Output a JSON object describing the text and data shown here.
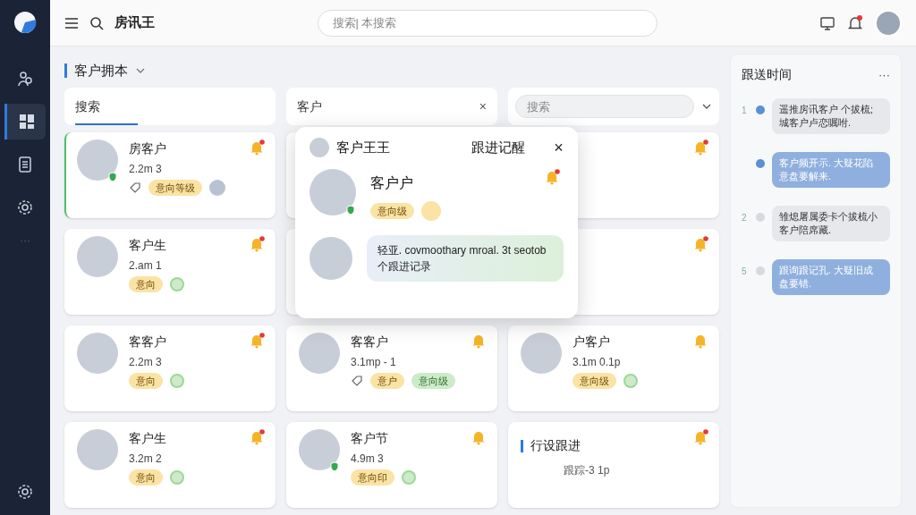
{
  "app": {
    "title": "房讯王",
    "search_placeholder": "搜索| 本搜索"
  },
  "sidebar": {
    "items": [
      {
        "selected": false
      },
      {
        "selected": true
      },
      {
        "selected": false
      },
      {
        "selected": false
      }
    ],
    "more": "···"
  },
  "page": {
    "title": "客户拥本"
  },
  "filters": {
    "search_label": "搜索",
    "customer_label": "客户",
    "customer_clear": "×",
    "search_placeholder": "搜索"
  },
  "cards": [
    {
      "kind": "customer",
      "selected": true,
      "name": "房客户",
      "meta": "2.2m  3",
      "alert": true,
      "online": true,
      "tags": [
        {
          "kind": "yellow",
          "label": "意向等级"
        }
      ],
      "note_icon": true,
      "agent": true
    },
    {
      "kind": "covered"
    },
    {
      "kind": "covered",
      "alert": true
    },
    {
      "kind": "customer",
      "selected": false,
      "name": "客户生",
      "meta": "2.am  1",
      "alert": true,
      "online": false,
      "tags": [
        {
          "kind": "yellow",
          "label": "意向"
        },
        {
          "kind": "green-dot"
        }
      ],
      "note_icon": false,
      "agent": false
    },
    {
      "kind": "covered"
    },
    {
      "kind": "covered",
      "alert": true
    },
    {
      "kind": "customer",
      "selected": false,
      "name": "客客户",
      "meta": "2.2m  3",
      "alert": true,
      "online": false,
      "tags": [
        {
          "kind": "yellow",
          "label": "意向"
        },
        {
          "kind": "green-dot"
        }
      ],
      "note_icon": false,
      "agent": false
    },
    {
      "kind": "customer",
      "selected": false,
      "name": "客客户",
      "meta": "3.1mp - 1",
      "alert": false,
      "online": false,
      "tags": [
        {
          "kind": "yellow",
          "label": "意户"
        },
        {
          "kind": "green",
          "label": "意向级"
        }
      ],
      "note_icon": true,
      "agent": false
    },
    {
      "kind": "customer",
      "selected": false,
      "name": "户客户",
      "meta": "3.1m  0.1p",
      "alert": false,
      "online": false,
      "tags": [
        {
          "kind": "yellow",
          "label": "意向级"
        },
        {
          "kind": "green-dot"
        }
      ],
      "note_icon": false,
      "agent": false
    },
    {
      "kind": "customer",
      "selected": false,
      "name": "客户生",
      "meta": "3.2m  2",
      "alert": true,
      "online": false,
      "tags": [
        {
          "kind": "yellow",
          "label": "意向"
        },
        {
          "kind": "green-dot"
        }
      ],
      "note_icon": false,
      "agent": false
    },
    {
      "kind": "customer",
      "selected": false,
      "name": "客户节",
      "meta": "4.9m  3",
      "alert": false,
      "online": true,
      "tags": [
        {
          "kind": "yellow",
          "label": "意向印"
        },
        {
          "kind": "green-dot"
        }
      ],
      "note_icon": false,
      "agent": false
    },
    {
      "kind": "followup",
      "selected": false,
      "name": "行设跟进",
      "meta": "跟踪-3 1p",
      "alert": true
    }
  ],
  "popup": {
    "customer": "客户王王",
    "title": "跟进记醒",
    "close": "×",
    "name": "客户户",
    "alert": true,
    "online": true,
    "tags": [
      {
        "kind": "yellow",
        "label": "意向级"
      },
      {
        "kind": "yellow-dot"
      }
    ],
    "message": "轻亚. covmoothary mroal. 3t seotob个跟进记录"
  },
  "timeline": {
    "title": "跟送时间",
    "more": "···",
    "items": [
      {
        "number": "1",
        "text": "遥推房讯客户 个拔梳;城客户卢恋嘱咐.",
        "active": true
      },
      {
        "text": "客户频开示. 大疑花陷意盘要解来.",
        "active": true
      },
      {
        "number": "2",
        "text": "雏熄屠属委卡个拔梳小客户陪席藏.",
        "active": false
      },
      {
        "number": "5",
        "text": "跟询跟记孔. 大疑旧成盘要错.",
        "active": false
      }
    ]
  }
}
